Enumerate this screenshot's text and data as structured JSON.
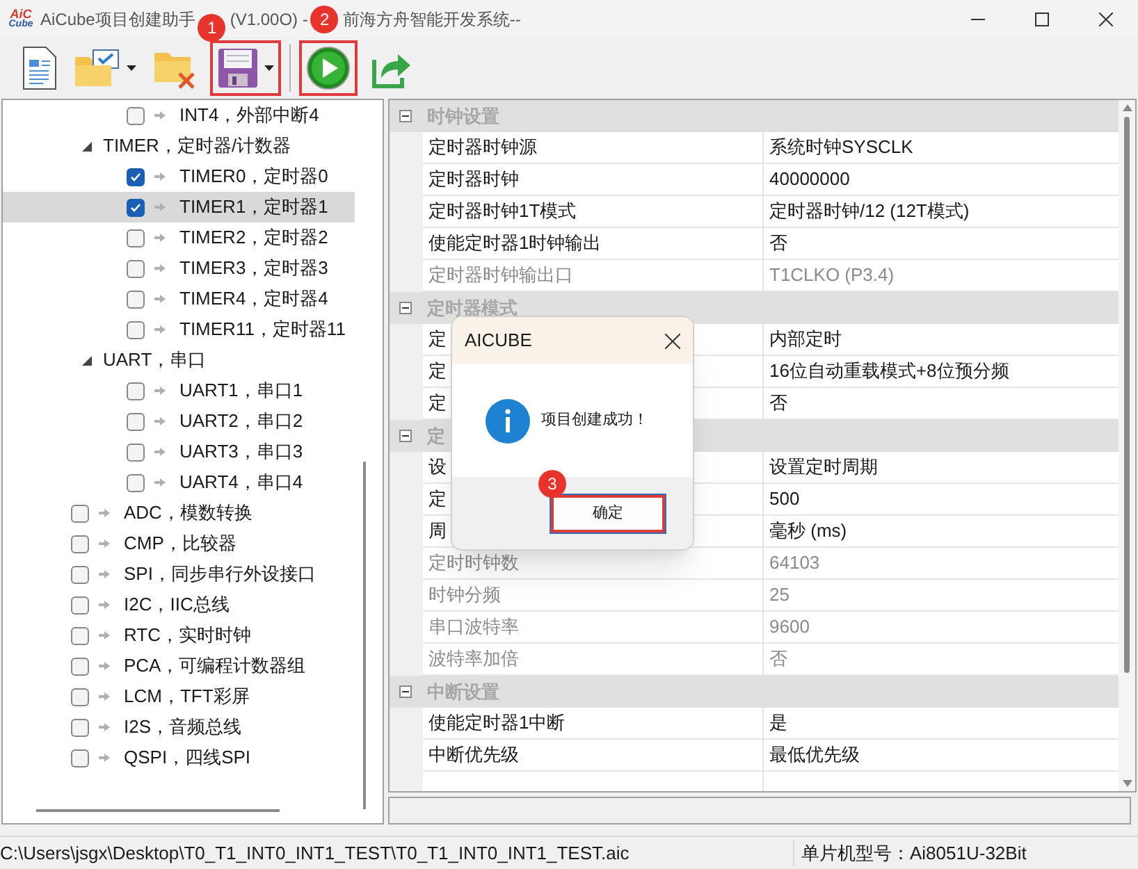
{
  "window": {
    "logo": [
      "AiC",
      "Cube"
    ],
    "title": [
      "AiCube项目创建助手",
      "(V1.00O) -",
      "前海方舟智能开发系统--"
    ]
  },
  "toolbar": [
    {
      "kind": "new",
      "dropdown": false
    },
    {
      "kind": "open",
      "dropdown": true
    },
    {
      "kind": "close",
      "dropdown": false
    },
    {
      "kind": "save",
      "dropdown": true
    },
    {
      "kind": "run",
      "dropdown": false
    },
    {
      "kind": "export",
      "dropdown": false
    }
  ],
  "tree": {
    "items": [
      {
        "kind": "continued",
        "children": [
          {
            "label": "INT4，外部中断4",
            "checked": false,
            "selected": false
          }
        ]
      },
      {
        "kind": "group",
        "label": "TIMER，定时器/计数器",
        "expanded": true,
        "children": [
          {
            "label": "TIMER0，定时器0",
            "checked": true,
            "selected": false
          },
          {
            "label": "TIMER1，定时器1",
            "checked": true,
            "selected": true
          },
          {
            "label": "TIMER2，定时器2",
            "checked": false,
            "selected": false
          },
          {
            "label": "TIMER3，定时器3",
            "checked": false,
            "selected": false
          },
          {
            "label": "TIMER4，定时器4",
            "checked": false,
            "selected": false
          },
          {
            "label": "TIMER11，定时器11",
            "checked": false,
            "selected": false
          }
        ]
      },
      {
        "kind": "group",
        "label": "UART，串口",
        "expanded": true,
        "children": [
          {
            "label": "UART1，串口1",
            "checked": false,
            "selected": false
          },
          {
            "label": "UART2，串口2",
            "checked": false,
            "selected": false
          },
          {
            "label": "UART3，串口3",
            "checked": false,
            "selected": false
          },
          {
            "label": "UART4，串口4",
            "checked": false,
            "selected": false
          }
        ]
      },
      {
        "kind": "leaf",
        "label": "ADC，模数转换",
        "checked": false,
        "selected": false
      },
      {
        "kind": "leaf",
        "label": "CMP，比较器",
        "checked": false,
        "selected": false
      },
      {
        "kind": "leaf",
        "label": "SPI，同步串行外设接口",
        "checked": false,
        "selected": false
      },
      {
        "kind": "leaf",
        "label": "I2C，IIC总线",
        "checked": false,
        "selected": false
      },
      {
        "kind": "leaf",
        "label": "RTC，实时时钟",
        "checked": false,
        "selected": false
      },
      {
        "kind": "leaf",
        "label": "PCA，可编程计数器组",
        "checked": false,
        "selected": false
      },
      {
        "kind": "leaf",
        "label": "LCM，TFT彩屏",
        "checked": false,
        "selected": false
      },
      {
        "kind": "leaf",
        "label": "I2S，音频总线",
        "checked": false,
        "selected": false
      },
      {
        "kind": "leaf",
        "label": "QSPI，四线SPI",
        "checked": false,
        "selected": false
      }
    ]
  },
  "properties": {
    "sections": [
      {
        "title": "时钟设置",
        "expanded": true,
        "rows": [
          {
            "label": "定时器时钟源",
            "value": "系统时钟SYSCLK",
            "disabled": false
          },
          {
            "label": "定时器时钟",
            "value": "40000000",
            "disabled": false
          },
          {
            "label": "定时器时钟1T模式",
            "value": "定时器时钟/12 (12T模式)",
            "disabled": false
          },
          {
            "label": "使能定时器1时钟输出",
            "value": "否",
            "disabled": false
          },
          {
            "label": "定时器时钟输出口",
            "value": "T1CLKO (P3.4)",
            "disabled": true
          }
        ]
      },
      {
        "title": "定时器模式",
        "expanded": true,
        "rows": [
          {
            "label": "定",
            "value": "内部定时",
            "disabled": false
          },
          {
            "label": "定",
            "value": "16位自动重载模式+8位预分频",
            "disabled": false
          },
          {
            "label": "定",
            "value": "否",
            "disabled": false
          }
        ]
      },
      {
        "title": "定",
        "expanded": true,
        "rows": [
          {
            "label": "设",
            "value": "设置定时周期",
            "disabled": false
          },
          {
            "label": "定",
            "value": "500",
            "disabled": false
          },
          {
            "label": "周",
            "value": "毫秒 (ms)",
            "disabled": false
          },
          {
            "label": "定时时钟数",
            "value": "64103",
            "disabled": true
          },
          {
            "label": "时钟分频",
            "value": "25",
            "disabled": true
          },
          {
            "label": "串口波特率",
            "value": "9600",
            "disabled": true
          },
          {
            "label": "波特率加倍",
            "value": "否",
            "disabled": true
          }
        ]
      },
      {
        "title": "中断设置",
        "expanded": true,
        "rows": [
          {
            "label": "使能定时器1中断",
            "value": "是",
            "disabled": false
          },
          {
            "label": "中断优先级",
            "value": "最低优先级",
            "disabled": false
          }
        ]
      }
    ]
  },
  "dialog": {
    "title": "AICUBE",
    "message": "项目创建成功！",
    "button": "确定"
  },
  "annotations": [
    "1",
    "2",
    "3"
  ],
  "status_bar": {
    "path": "C:\\Users\\jsgx\\Desktop\\T0_T1_INT0_INT1_TEST\\T0_T1_INT0_INT1_TEST.aic",
    "chip": "单片机型号：Ai8051U-32Bit"
  }
}
